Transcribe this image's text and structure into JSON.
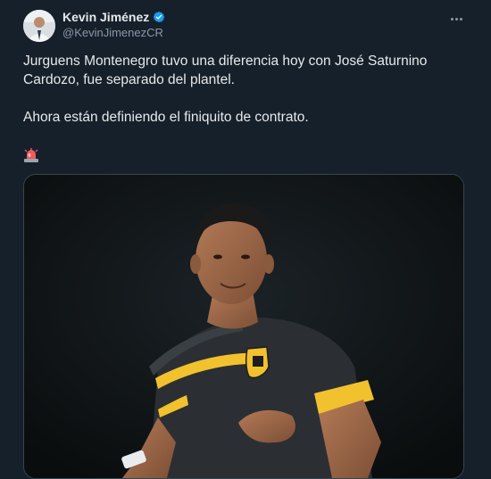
{
  "author": {
    "name": "Kevin Jiménez",
    "handle": "@KevinJimenezCR",
    "verified": true
  },
  "tweet": {
    "paragraph_1": "Jurguens Montenegro tuvo una diferencia hoy con José Saturnino Cardozo, fue separado del plantel.",
    "paragraph_2": "Ahora están definiendo el finiquito de contrato."
  },
  "icons": {
    "verified": "verified-badge-icon",
    "more": "more-options-icon",
    "emoji": "police-light-emoji-icon"
  },
  "colors": {
    "background": "#15202b",
    "text_primary": "#e7e9ea",
    "text_secondary": "#8b98a5",
    "verified_blue": "#1d9bf0",
    "jersey_yellow": "#f2c12e"
  }
}
